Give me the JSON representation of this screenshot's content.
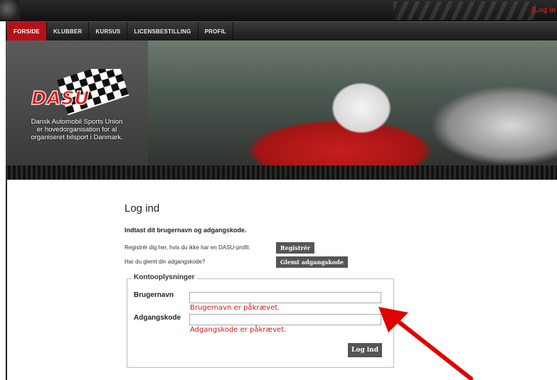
{
  "topbar": {
    "login_link": "[Log in"
  },
  "nav": {
    "tabs": [
      {
        "label": "FORSIDE",
        "active": true
      },
      {
        "label": "KLUBBER"
      },
      {
        "label": "KURSUS"
      },
      {
        "label": "LICENSBESTILLING"
      },
      {
        "label": "PROFIL"
      }
    ]
  },
  "banner": {
    "logo_text": "DASU",
    "tagline": [
      "Dansk Automobil Sports Union",
      "er hovedorganisation for al",
      "organiseret bilsport i Danmark."
    ]
  },
  "login": {
    "title": "Log ind",
    "intro": "Indtast dit brugernavn og adgangskode.",
    "register_text": "Registrér dig her, hvis du ikke har en DASU-profil:",
    "register_button": "Registrér",
    "forgot_text": "Har du glemt din adgangskode?",
    "forgot_button": "Glemt adgangskode",
    "fieldset_legend": "Kontooplysninger",
    "username_label": "Brugernavn",
    "username_value": "",
    "username_error": "Brugernavn er påkrævet.",
    "password_label": "Adgangskode",
    "password_value": "",
    "password_error": "Adgangskode er påkrævet.",
    "submit": "Log ind"
  },
  "colors": {
    "accent": "#b31217",
    "error": "#d01818",
    "annotation_arrow": "#e00000"
  }
}
